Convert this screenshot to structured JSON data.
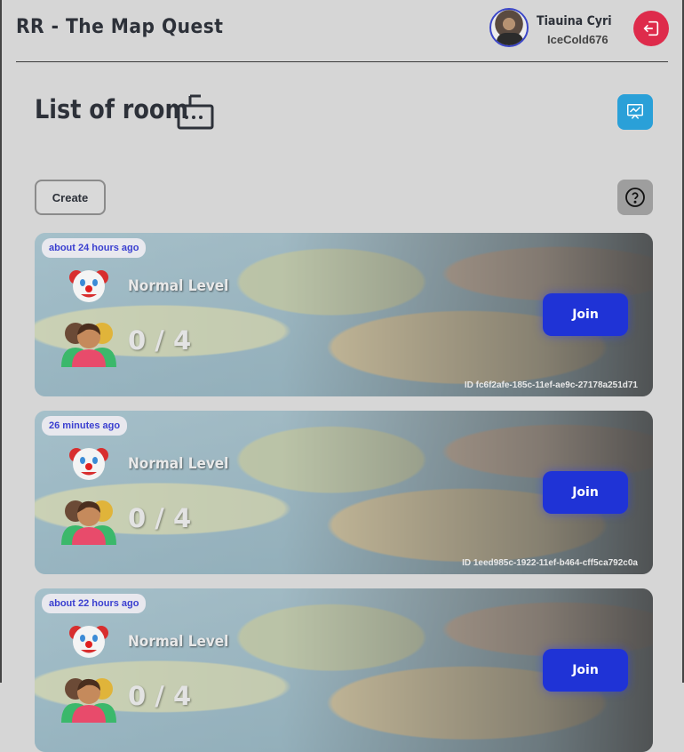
{
  "header": {
    "app_title": "RR - The Map Quest",
    "user_name": "Tiauina Cyri",
    "user_handle": "IceCold676"
  },
  "page": {
    "title": "List of room",
    "create_label": "Create"
  },
  "rooms": [
    {
      "time": "about 24 hours ago",
      "level": "Normal Level",
      "players": "0 / 4",
      "join_label": "Join",
      "id": "ID fc6f2afe-185c-11ef-ae9c-27178a251d71"
    },
    {
      "time": "26 minutes ago",
      "level": "Normal Level",
      "players": "0 / 4",
      "join_label": "Join",
      "id": "ID 1eed985c-1922-11ef-b464-cff5ca792c0a"
    },
    {
      "time": "about 22 hours ago",
      "level": "Normal Level",
      "players": "0 / 4",
      "join_label": "Join",
      "id": ""
    }
  ],
  "icons": {
    "logout": "logout-icon",
    "stats": "chart-board-icon",
    "help": "question-circle-icon",
    "room_type": "radio-icon",
    "level": "clown-icon",
    "players": "people-icon"
  },
  "colors": {
    "background": "#d6d6d6",
    "logout": "#de2b4b",
    "stats": "#2aa0d8",
    "join": "#1f33d6",
    "badge_text": "#3a3fd0"
  }
}
